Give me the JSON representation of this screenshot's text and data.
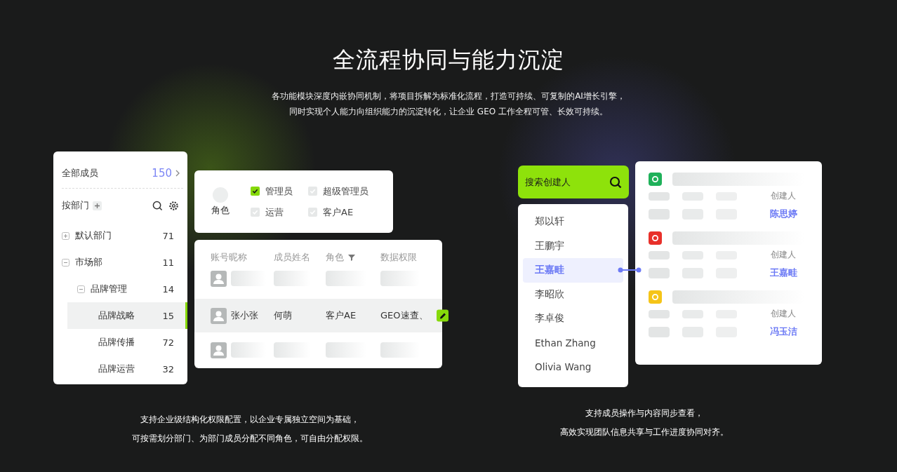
{
  "heading": {
    "title": "全流程协同与能力沉淀",
    "subtitle_lines": [
      "各功能模块深度内嵌协同机制，将项目拆解为标准化流程，打造可持续、可复制的AI增长引擎，",
      "同时实现个人能力向组织能力的沉淀转化，让企业 GEO 工作全程可管、长效可持续。"
    ]
  },
  "members": {
    "label": "全部成员",
    "count": "150",
    "group_label": "按部门",
    "tree": [
      {
        "label": "默认部门",
        "count": "71",
        "expanded": false,
        "selected": false
      },
      {
        "label": "市场部",
        "count": "11",
        "expanded": true,
        "selected": false,
        "children": [
          {
            "label": "品牌管理",
            "count": "14",
            "expanded": true,
            "selected": false,
            "children": [
              {
                "label": "品牌战略",
                "count": "15",
                "selected": true
              },
              {
                "label": "品牌传播",
                "count": "72",
                "selected": false
              },
              {
                "label": "品牌运营",
                "count": "32",
                "selected": false
              }
            ]
          }
        ]
      }
    ]
  },
  "roles": {
    "label": "角色",
    "options": [
      {
        "label": "管理员",
        "checked": true
      },
      {
        "label": "超级管理员",
        "checked": false
      },
      {
        "label": "运营",
        "checked": false
      },
      {
        "label": "客户AE",
        "checked": false
      }
    ]
  },
  "table": {
    "columns": [
      "账号昵称",
      "成员姓名",
      "角色",
      "数据权限"
    ],
    "rows": [
      {
        "kind": "placeholder"
      },
      {
        "kind": "data",
        "cells": [
          "张小张",
          "何萌",
          "客户AE",
          "GEO速查、"
        ]
      },
      {
        "kind": "placeholder"
      }
    ]
  },
  "left_caption": [
    "支持企业级结构化权限配置，以企业专属独立空间为基础，",
    "可按需划分部门、为部门成员分配不同角色，可自由分配权限。"
  ],
  "creator_search": {
    "placeholder": "搜索创建人",
    "names": [
      {
        "label": "郑以轩",
        "selected": false
      },
      {
        "label": "王鹏宇",
        "selected": false
      },
      {
        "label": "王嘉畦",
        "selected": true
      },
      {
        "label": "李昭欣",
        "selected": false
      },
      {
        "label": "李卓俊",
        "selected": false
      },
      {
        "label": "Ethan Zhang",
        "selected": false
      },
      {
        "label": "Olivia Wang",
        "selected": false
      }
    ]
  },
  "contents": [
    {
      "color": "#1fb15a",
      "creator_label": "创建人",
      "creator": "陈思婷"
    },
    {
      "color": "#e8302a",
      "creator_label": "创建人",
      "creator": "王嘉畦"
    },
    {
      "color": "#f5c418",
      "creator_label": "创建人",
      "creator": "冯玉洁"
    }
  ],
  "right_caption": [
    "支持成员操作与内容同步查看，",
    "高效实现团队信息共享与工作进度协同对齐。"
  ]
}
